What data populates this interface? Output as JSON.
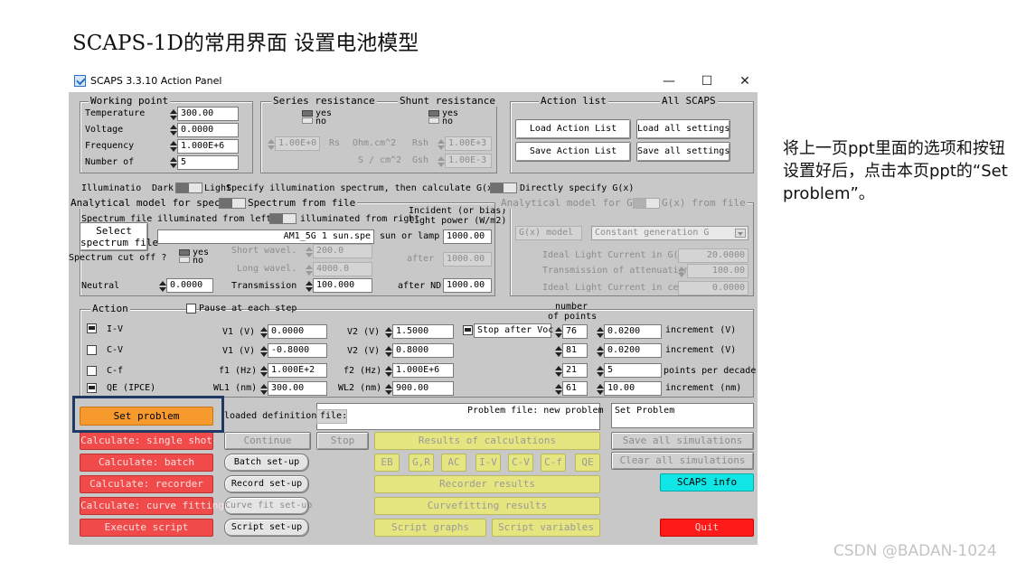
{
  "slide": {
    "title": "SCAPS-1D的常用界面 设置电池模型",
    "note": "将上一页ppt里面的选项和按钮设置好后，点击本页ppt的“Set problem”。",
    "watermark": "CSDN @BADAN-1024"
  },
  "window": {
    "title": "SCAPS 3.3.10 Action Panel",
    "minimize": "—",
    "maximize": "☐",
    "close": "✕"
  },
  "working_point": {
    "legend": "Working point",
    "rows": [
      {
        "label": "Temperature",
        "value": "300.00"
      },
      {
        "label": "Voltage",
        "value": "0.0000"
      },
      {
        "label": "Frequency",
        "value": "1.000E+6"
      },
      {
        "label": "Number of",
        "value": "5"
      }
    ]
  },
  "series": {
    "legend": "Series resistance",
    "yes": "yes",
    "no": "no",
    "value": "1.00E+0",
    "rs": "Rs",
    "unit1": "Ohm.cm^2",
    "unit2": "S / cm^2"
  },
  "shunt": {
    "legend": "Shunt resistance",
    "yes": "yes",
    "no": "no",
    "rsh": "Rsh",
    "rsh_value": "1.00E+3",
    "gsh": "Gsh",
    "gsh_value": "1.00E-3"
  },
  "action_list": {
    "legend": "Action list",
    "all_scaps": "All SCAPS",
    "load_action": "Load Action List",
    "save_action": "Save Action List",
    "load_all": "Load all settings",
    "save_all": "Save all settings"
  },
  "illumination": {
    "label": "Illuminatio",
    "dark": "Dark",
    "light": "Light",
    "specify_spectrum": "Specify illumination spectrum, then calculate G(x)",
    "directly_specify": "Directly specify G(x)",
    "analytical_model": "Analytical model for spectrum",
    "spectrum_from_file": "Spectrum from file",
    "spectrum_file": "Spectrum file",
    "illuminated_from_left": "illuminated from left",
    "illuminated_from_right": "illuminated from right",
    "incident_bias": "Incident (or bias)",
    "light_power": "light power (W/m2)",
    "select_spectrum_1": "Select",
    "select_spectrum_2": "spectrum file",
    "spectrum_filename": "AM1_5G 1 sun.spe",
    "sun_or_lamp": "sun or lamp",
    "sun_or_lamp_value": "1000.00",
    "spectrum_cut_off": "Spectrum cut off ?",
    "yes": "yes",
    "no": "no",
    "short_wavel": "Short wavel.",
    "short_wavel_value": "200.0",
    "after": "after",
    "after_value": "1000.00",
    "long_wavel": "Long wavel.",
    "long_wavel_value": "4000.0",
    "neutral": "Neutral",
    "neutral_value": "0.0000",
    "transmission": "Transmission",
    "transmission_value": "100.000",
    "after_nd": "after ND",
    "after_nd_value": "1000.00"
  },
  "generation": {
    "analytical_model": "Analytical model for G(x)",
    "gx_from_file": "G(x) from file",
    "gx_model": "G(x) model",
    "gx_model_value": "Constant generation G",
    "ideal_light_current": "Ideal Light Current in G(x)",
    "ideal_light_current_value": "20.0000",
    "transmission_attenuation": "Transmission of attenuation",
    "transmission_attenuation_value": "100.00",
    "ideal_light_current_cell": "Ideal Light Current in cell",
    "ideal_light_current_cell_value": "0.0000"
  },
  "action": {
    "legend": "Action",
    "pause": "Pause at each step",
    "number_of_points_1": "number",
    "number_of_points_2": "of points",
    "stop_after_voc": "Stop after Voc",
    "rows": [
      {
        "name": "I-V",
        "checked": true,
        "p1_label": "V1 (V)",
        "p1": "0.0000",
        "p2_label": "V2 (V)",
        "p2": "1.5000",
        "points": "76",
        "inc": "0.0200",
        "inc_label": "increment (V)"
      },
      {
        "name": "C-V",
        "checked": false,
        "p1_label": "V1 (V)",
        "p1": "-0.8000",
        "p2_label": "V2 (V)",
        "p2": "0.8000",
        "points": "81",
        "inc": "0.0200",
        "inc_label": "increment (V)"
      },
      {
        "name": "C-f",
        "checked": false,
        "p1_label": "f1 (Hz)",
        "p1": "1.000E+2",
        "p2_label": "f2 (Hz)",
        "p2": "1.000E+6",
        "points": "21",
        "inc": "5",
        "inc_label": "points per decade"
      },
      {
        "name": "QE (IPCE)",
        "checked": true,
        "p1_label": "WL1 (nm)",
        "p1": "300.00",
        "p2_label": "WL2 (nm)",
        "p2": "900.00",
        "points": "61",
        "inc": "10.00",
        "inc_label": "increment (nm)"
      }
    ]
  },
  "buttons": {
    "set_problem": "Set problem",
    "loaded_definition": "loaded definition",
    "file_label": "file:",
    "problem_file": "Problem file: new problem",
    "set_problem_box": "Set Problem",
    "calc_single": "Calculate: single shot",
    "continue": "Continue",
    "stop": "Stop",
    "results_of_calculations": "Results of calculations",
    "save_all_sim": "Save all simulations",
    "calc_batch": "Calculate: batch",
    "batch_setup": "Batch set-up",
    "eb": "EB",
    "gr": "G,R",
    "ac": "AC",
    "iv": "I-V",
    "cv": "C-V",
    "cf": "C-f",
    "qe": "QE",
    "clear_all_sim": "Clear all simulations",
    "calc_recorder": "Calculate: recorder",
    "record_setup": "Record set-up",
    "recorder_results": "Recorder results",
    "scaps_info": "SCAPS info",
    "calc_curve": "Calculate: curve fitting",
    "curve_setup": "Curve fit set-up",
    "curvefitting_results": "Curvefitting results",
    "execute_script": "Execute script",
    "script_setup": "Script set-up",
    "script_graphs": "Script graphs",
    "script_variables": "Script variables",
    "quit": "Quit"
  }
}
